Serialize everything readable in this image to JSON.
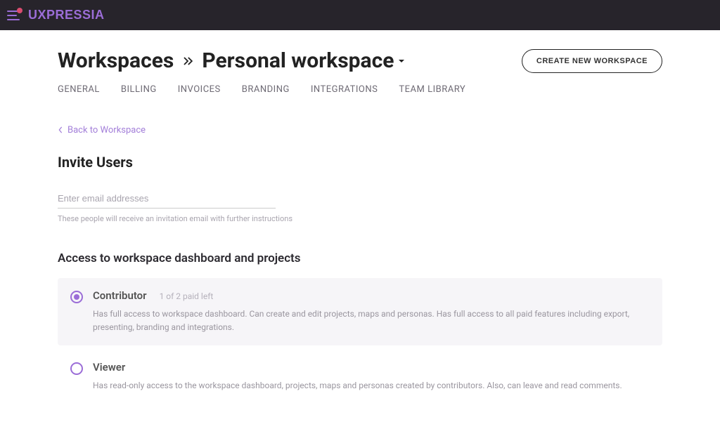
{
  "brand": "UXPRESSIA",
  "breadcrumb": {
    "root": "Workspaces",
    "current": "Personal workspace"
  },
  "create_button": "CREATE NEW WORKSPACE",
  "tabs": [
    "GENERAL",
    "BILLING",
    "INVOICES",
    "BRANDING",
    "INTEGRATIONS",
    "TEAM LIBRARY"
  ],
  "back_link": "Back to Workspace",
  "invite": {
    "title": "Invite Users",
    "placeholder": "Enter email addresses",
    "hint": "These people will receive an invitation email with further instructions"
  },
  "access": {
    "title": "Access to workspace dashboard and projects",
    "roles": [
      {
        "name": "Contributor",
        "meta": "1 of 2 paid left",
        "desc": "Has full access to workspace dashboard. Can create and edit projects, maps and personas. Has full access to all paid features including export, presenting, branding and integrations."
      },
      {
        "name": "Viewer",
        "meta": "",
        "desc": "Has read-only access to the workspace dashboard, projects, maps and personas created by contributors. Also, can leave and read comments."
      }
    ]
  }
}
